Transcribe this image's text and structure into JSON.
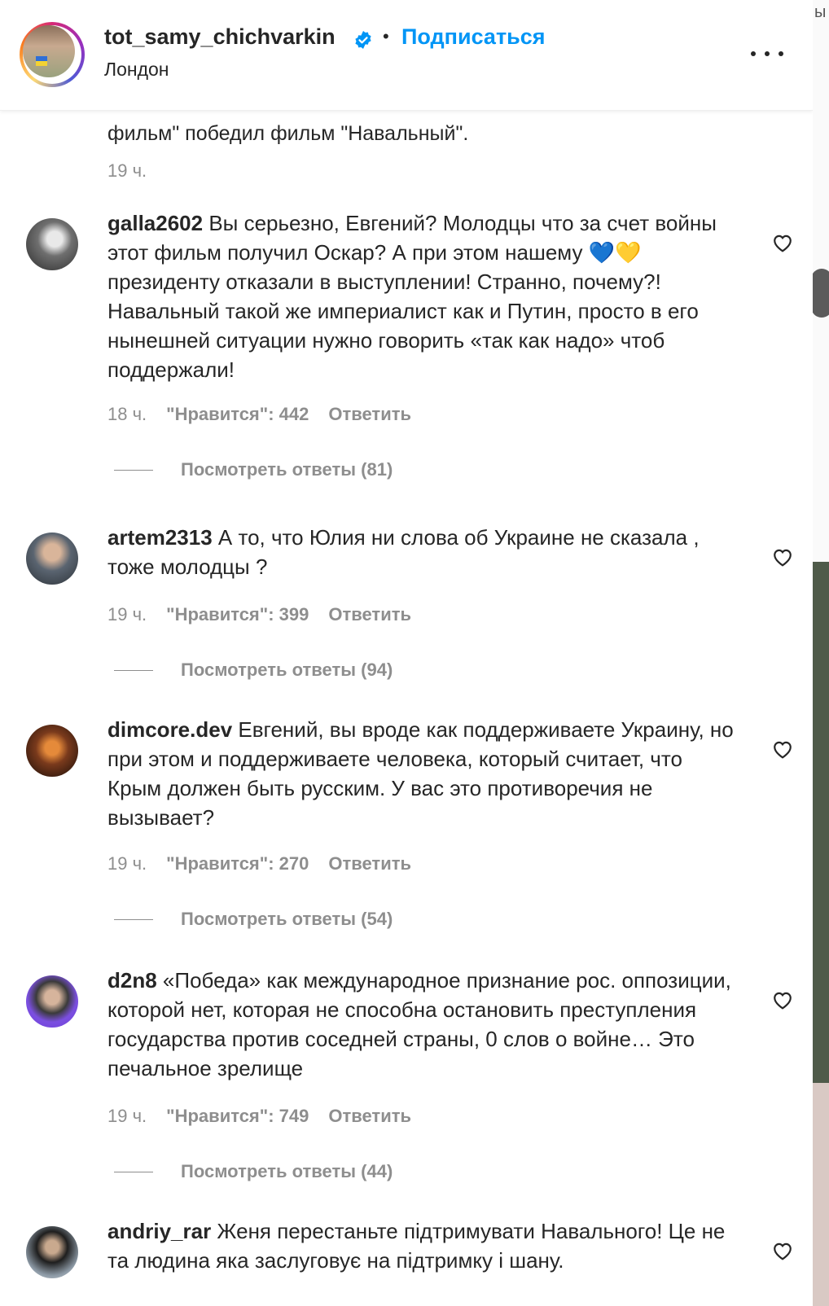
{
  "header": {
    "username": "tot_samy_chichvarkin",
    "follow_label": "Подписаться",
    "location": "Лондон",
    "separator": "•"
  },
  "previous_comment": {
    "text_tail": "фильм\" победил фильм \"Навальный\".",
    "time": "19 ч."
  },
  "comments": [
    {
      "username": "galla2602",
      "text": "Вы серьезно, Евгений? Молодцы что за счет войны этот фильм получил Оскар? А при этом нашему 💙💛 президенту отказали в выступлении! Странно, почему?! Навальный такой же империалист как и Путин, просто в его нынешней ситуации нужно говорить «так как надо» чтоб поддержали!",
      "time": "18 ч.",
      "likes": "\"Нравится\": 442",
      "reply": "Ответить",
      "view_replies": "Посмотреть ответы (81)"
    },
    {
      "username": "artem2313",
      "text": "А то, что Юлия ни слова об Украине не сказала , тоже молодцы ?",
      "time": "19 ч.",
      "likes": "\"Нравится\": 399",
      "reply": "Ответить",
      "view_replies": "Посмотреть ответы (94)"
    },
    {
      "username": "dimcore.dev",
      "text": "Евгений, вы вроде как поддерживаете Украину, но при этом и поддерживаете человека, который считает, что Крым должен быть русским. У вас это противоречия не вызывает?",
      "time": "19 ч.",
      "likes": "\"Нравится\": 270",
      "reply": "Ответить",
      "view_replies": "Посмотреть ответы (54)"
    },
    {
      "username": "d2n8",
      "text": "«Победа» как международное признание рос. оппозиции, которой нет, которая не способна остановить преступления государства против соседней страны, 0 слов о войне… Это печальное зрелище",
      "time": "19 ч.",
      "likes": "\"Нравится\": 749",
      "reply": "Ответить",
      "view_replies": "Посмотреть ответы (44)"
    },
    {
      "username": "andriy_rar",
      "text": "Женя перестаньте підтримувати Навального! Це не та людина яка заслуговує на підтримку і шану."
    }
  ],
  "backdrop": {
    "glyph": "ы"
  },
  "colors": {
    "link": "#0095f6",
    "muted": "#8e8e8e",
    "text": "#262626",
    "verified": "#0095f6"
  },
  "icons": [
    "verified-badge-icon",
    "more-options-icon",
    "heart-icon"
  ]
}
